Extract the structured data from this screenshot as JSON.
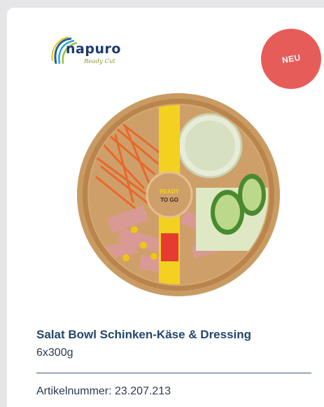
{
  "brand": {
    "name": "napuro",
    "tagline": "Ready Cut"
  },
  "badge": {
    "label": "NEU",
    "color": "#e65c59"
  },
  "product_image": {
    "icon": "salad-bowl-image",
    "band_text": [
      "READY",
      "TO GO"
    ]
  },
  "product": {
    "title": "Salat Bowl Schinken-Käse & Dressing",
    "quantity": "6x300g",
    "article_number": "Artikelnummer: 23.207.213"
  },
  "colors": {
    "title": "#24476b",
    "text": "#2a3b52",
    "background": "#e6e6e9"
  }
}
